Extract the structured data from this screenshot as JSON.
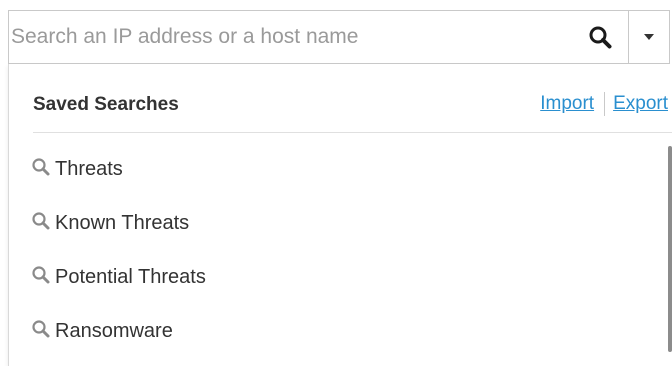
{
  "search": {
    "placeholder": "Search an IP address or a host name",
    "value": ""
  },
  "icons": {
    "search_button": "search-icon",
    "dropdown": "caret-down-icon",
    "item": "magnifier-icon"
  },
  "saved_searches": {
    "title": "Saved Searches",
    "import_label": "Import",
    "export_label": "Export",
    "items": [
      {
        "label": "Threats"
      },
      {
        "label": "Known Threats"
      },
      {
        "label": "Potential Threats"
      },
      {
        "label": "Ransomware"
      }
    ]
  },
  "colors": {
    "link": "#2a8fcf",
    "border": "#c9c9c9",
    "text": "#333333",
    "placeholder": "#9a9a9a",
    "item_icon": "#8a8a8a"
  }
}
